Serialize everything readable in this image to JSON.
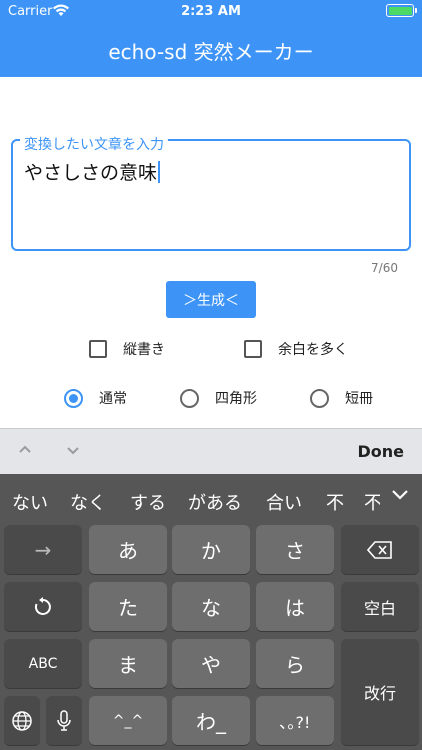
{
  "status": {
    "carrier": "Carrier",
    "time": "2:23 AM",
    "battery_level": 1.0
  },
  "app": {
    "title": "echo-sd 突然メーカー",
    "accent": "#3d94f6"
  },
  "input": {
    "label": "変換したい文章を入力",
    "value": "やさしさの意味",
    "counter": "7/60"
  },
  "generate_button": "＞生成＜",
  "checkboxes": [
    {
      "label": "縦書き",
      "checked": false
    },
    {
      "label": "余白を多く",
      "checked": false
    }
  ],
  "radios": [
    {
      "label": "通常",
      "selected": true
    },
    {
      "label": "四角形",
      "selected": false
    },
    {
      "label": "短冊",
      "selected": false
    }
  ],
  "accessory": {
    "prev_icon": "chevron-up-icon",
    "next_icon": "chevron-down-icon",
    "done": "Done"
  },
  "keyboard": {
    "suggestions": [
      "ない",
      "なく",
      "する",
      "がある",
      "合い",
      "不",
      "不"
    ],
    "keys": {
      "arrow": "→",
      "a": "あ",
      "ka": "か",
      "sa": "さ",
      "backspace": "⌫",
      "undo": "↺",
      "ta": "た",
      "na": "な",
      "ha": "は",
      "space": "空白",
      "abc": "ABC",
      "ma": "ま",
      "ya": "や",
      "ra": "ら",
      "return": "改行",
      "globe": "globe-icon",
      "mic": "mic-icon",
      "kaomoji": "^_^",
      "wa": "わ_",
      "punct": "､｡?!"
    }
  }
}
